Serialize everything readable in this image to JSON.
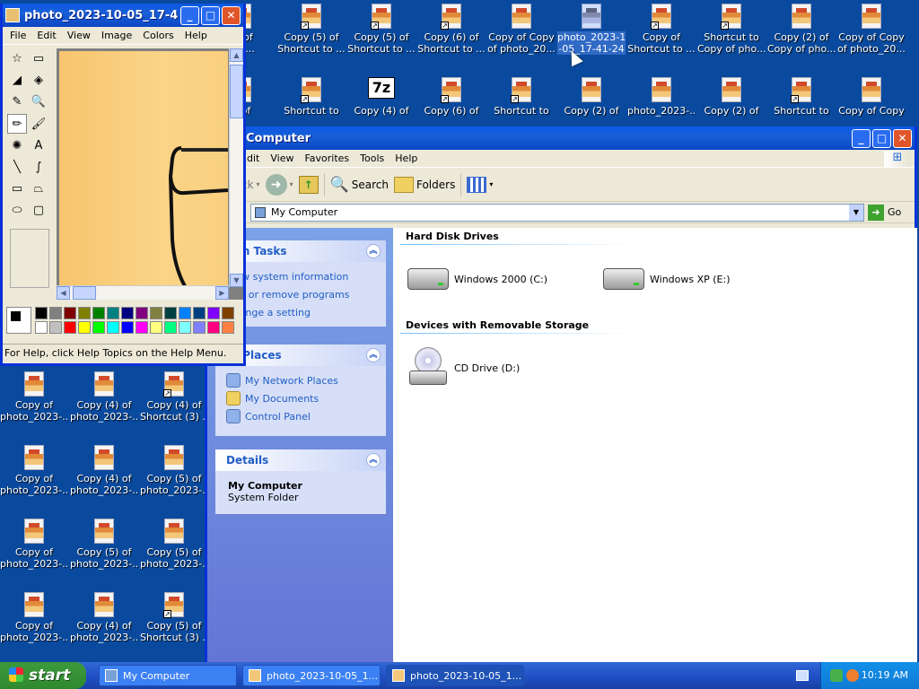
{
  "desktop": {
    "icons_row1": [
      {
        "label1": "2) of",
        "label2": "(2) ...",
        "shortcut": true
      },
      {
        "label1": "Copy (5) of",
        "label2": "Shortcut to ...",
        "shortcut": true
      },
      {
        "label1": "Copy (5) of",
        "label2": "Shortcut to ...",
        "shortcut": true
      },
      {
        "label1": "Copy (6) of",
        "label2": "Shortcut to ...",
        "shortcut": true
      },
      {
        "label1": "Copy of Copy",
        "label2": "of photo_20...",
        "shortcut": false
      },
      {
        "label1": "photo_2023-10",
        "label2": "-05_17-41-24",
        "shortcut": false,
        "selected": true
      },
      {
        "label1": "Copy of",
        "label2": "Shortcut to ...",
        "shortcut": true
      },
      {
        "label1": "Shortcut to",
        "label2": "Copy of pho...",
        "shortcut": true
      },
      {
        "label1": "Copy (2) of",
        "label2": "Copy of pho...",
        "shortcut": false
      },
      {
        "label1": "Copy of Copy",
        "label2": "of photo_20...",
        "shortcut": false
      }
    ],
    "icons_row2": [
      {
        "label1": "y of",
        "shortcut": true
      },
      {
        "label1": "Shortcut to",
        "shortcut": true
      },
      {
        "label1": "Copy (4) of",
        "shortcut": false,
        "sevenz": true
      },
      {
        "label1": "Copy (6) of",
        "shortcut": true
      },
      {
        "label1": "Shortcut to",
        "shortcut": true
      },
      {
        "label1": "Copy (2) of",
        "shortcut": false
      },
      {
        "label1": "photo_2023-...",
        "shortcut": false
      },
      {
        "label1": "Copy (2) of",
        "shortcut": false
      },
      {
        "label1": "Shortcut to",
        "shortcut": true
      },
      {
        "label1": "Copy of Copy",
        "shortcut": false
      }
    ],
    "sevenz_label": "7z",
    "icons_left": [
      {
        "label1": "Copy of",
        "label2": "photo_2023-...",
        "shortcut": false
      },
      {
        "label1": "Copy (4) of",
        "label2": "photo_2023-...",
        "shortcut": false
      },
      {
        "label1": "Copy (4) of",
        "label2": "Shortcut (3) ...",
        "shortcut": true
      },
      {
        "label1": "Copy of",
        "label2": "photo_2023-...",
        "shortcut": false
      },
      {
        "label1": "Copy (4) of",
        "label2": "photo_2023-...",
        "shortcut": false
      },
      {
        "label1": "Copy (5) of",
        "label2": "photo_2023-...",
        "shortcut": false
      },
      {
        "label1": "Copy of",
        "label2": "photo_2023-...",
        "shortcut": false
      },
      {
        "label1": "Copy (5) of",
        "label2": "photo_2023-...",
        "shortcut": false
      },
      {
        "label1": "Copy (5) of",
        "label2": "photo_2023-...",
        "shortcut": false
      },
      {
        "label1": "Copy of",
        "label2": "photo_2023-...",
        "shortcut": false
      },
      {
        "label1": "Copy (4) of",
        "label2": "photo_2023-...",
        "shortcut": false
      },
      {
        "label1": "Copy (5) of",
        "label2": "Shortcut (3) ...",
        "shortcut": true
      }
    ]
  },
  "paint": {
    "title": "photo_2023-10-05_17-4...",
    "menu": [
      "File",
      "Edit",
      "View",
      "Image",
      "Colors",
      "Help"
    ],
    "tools": [
      "free-select",
      "rect-select",
      "eraser",
      "fill",
      "color-picker",
      "magnifier",
      "pencil",
      "brush",
      "airbrush",
      "text",
      "line",
      "curve",
      "rectangle",
      "polygon",
      "ellipse",
      "rounded-rect"
    ],
    "tool_glyphs": [
      "☆",
      "▭",
      "◢",
      "◈",
      "✎",
      "🔍",
      "✏",
      "🖌",
      "✺",
      "A",
      "╲",
      "∫",
      "▭",
      "⏢",
      "⬭",
      "▢"
    ],
    "palette_colors": [
      "#000000",
      "#808080",
      "#800000",
      "#808000",
      "#008000",
      "#008080",
      "#000080",
      "#800080",
      "#808040",
      "#004040",
      "#0080ff",
      "#004080",
      "#8000ff",
      "#804000",
      "#ffffff",
      "#c0c0c0",
      "#ff0000",
      "#ffff00",
      "#00ff00",
      "#00ffff",
      "#0000ff",
      "#ff00ff",
      "#ffff80",
      "#00ff80",
      "#80ffff",
      "#8080ff",
      "#ff0080",
      "#ff8040"
    ],
    "status": "For Help, click Help Topics on the Help Menu."
  },
  "explorer": {
    "title": "Computer",
    "menu": [
      "dit",
      "View",
      "Favorites",
      "Tools",
      "Help"
    ],
    "toolbar": {
      "back": "ck",
      "search": "Search",
      "folders": "Folders"
    },
    "address": "My Computer",
    "go": "Go",
    "system_tasks": {
      "header": "tem Tasks",
      "items": [
        "View system information",
        "Add or remove programs",
        "Change a setting"
      ]
    },
    "other_places": {
      "header": "er Places",
      "items": [
        "My Network Places",
        "My Documents",
        "Control Panel"
      ]
    },
    "details": {
      "header": "Details",
      "name": "My Computer",
      "type": "System Folder"
    },
    "groups": {
      "hard_disks": {
        "label": "Hard Disk Drives",
        "items": [
          "Windows 2000 (C:)",
          "Windows XP (E:)"
        ]
      },
      "removable": {
        "label": "Devices with Removable Storage",
        "items": [
          "CD Drive (D:)"
        ]
      }
    }
  },
  "taskbar": {
    "start": "start",
    "tasks": [
      "My Computer",
      "photo_2023-10-05_1...",
      "photo_2023-10-05_1..."
    ],
    "clock": "10:19 AM"
  }
}
